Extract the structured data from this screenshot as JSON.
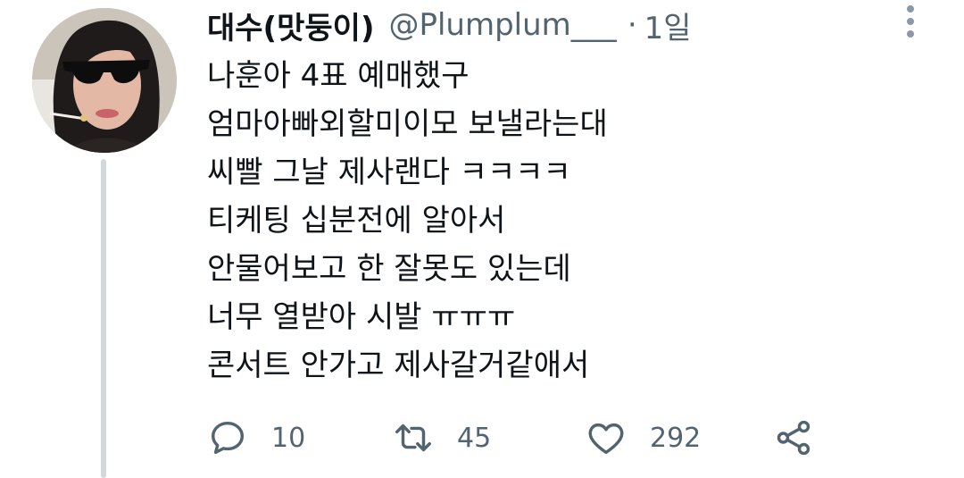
{
  "tweet": {
    "display_name": "대수(맛둥이)",
    "handle": "@Plumplum___",
    "separator": "·",
    "time": "1일",
    "lines": [
      "나훈아 4표 예매했구",
      "엄마아빠외할미이모 보낼라는대",
      "씨빨 그날 제사랜다 ㅋㅋㅋㅋ",
      "티케팅 십분전에 알아서",
      "안물어보고 한 잘못도 있는데",
      "너무 열받아 시발 ㅠㅠㅠ",
      "콘서트 안가고 제사갈거같애서"
    ]
  },
  "actions": {
    "reply": {
      "icon": "reply-icon",
      "count": "10"
    },
    "retweet": {
      "icon": "retweet-icon",
      "count": "45"
    },
    "like": {
      "icon": "heart-icon",
      "count": "292"
    },
    "share": {
      "icon": "share-icon"
    }
  },
  "icons": {
    "more": "more-vertical-icon"
  },
  "colors": {
    "text_primary": "#0f1419",
    "text_secondary": "#536471",
    "thread_line": "#cfd9de"
  }
}
